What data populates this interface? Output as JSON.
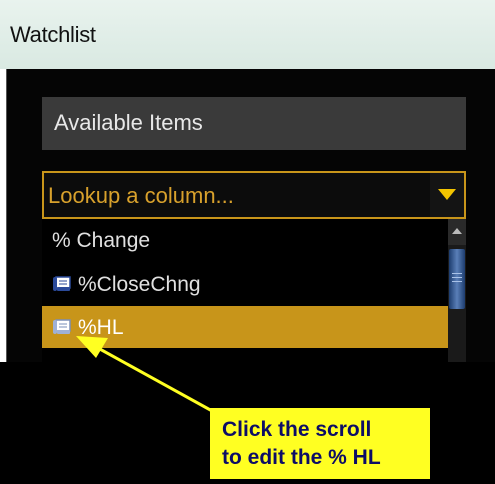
{
  "window": {
    "title": "Watchlist"
  },
  "panel": {
    "available_label": "Available Items",
    "lookup_placeholder": "Lookup a column...",
    "dropdown_icon": "chevron-down-icon"
  },
  "list": {
    "items": [
      {
        "label": "% Change",
        "icon": null,
        "selected": false
      },
      {
        "label": "%CloseChng",
        "icon": "scroll-icon",
        "selected": false
      },
      {
        "label": "%HL",
        "icon": "scroll-icon",
        "selected": true
      }
    ]
  },
  "callout": {
    "line1": "Click  the scroll",
    "line2": "to edit the % HL"
  },
  "colors": {
    "accent": "#c8951a",
    "callout_bg": "#ffff22",
    "callout_text": "#0d0d66",
    "panel_bg": "#050505"
  }
}
